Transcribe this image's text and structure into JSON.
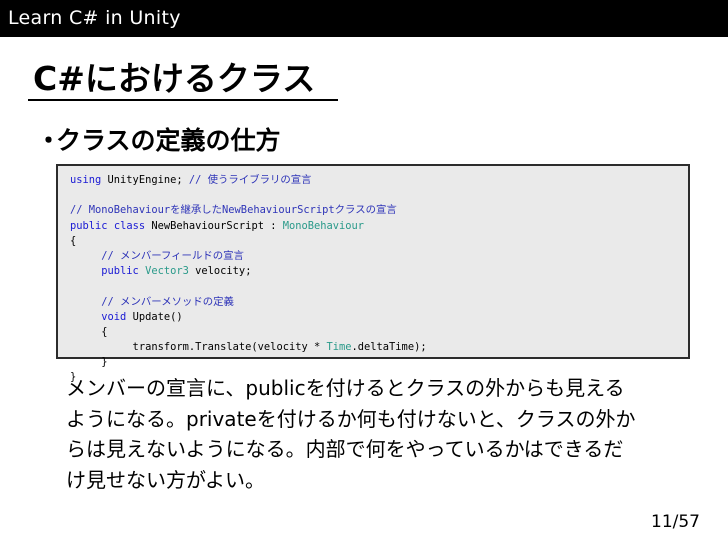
{
  "header": {
    "title": "Learn C# in Unity"
  },
  "slide": {
    "title": "C#におけるクラス",
    "bullet": {
      "marker": "・",
      "text": "クラスの定義の仕方"
    }
  },
  "code": [
    [
      {
        "t": "using",
        "c": "kw"
      },
      {
        "t": " UnityEngine; ",
        "c": ""
      },
      {
        "t": "// 使うライブラリの宣言",
        "c": "cm"
      }
    ],
    [],
    [
      {
        "t": "// MonoBehaviourを継承したNewBehaviourScriptクラスの宣言",
        "c": "cm"
      }
    ],
    [
      {
        "t": "public",
        "c": "kw"
      },
      {
        "t": " ",
        "c": ""
      },
      {
        "t": "class",
        "c": "kw"
      },
      {
        "t": " NewBehaviourScript : ",
        "c": ""
      },
      {
        "t": "MonoBehaviour",
        "c": "ty"
      }
    ],
    [
      {
        "t": "{",
        "c": ""
      }
    ],
    [
      {
        "t": "     ",
        "c": ""
      },
      {
        "t": "// メンバーフィールドの宣言",
        "c": "cm"
      }
    ],
    [
      {
        "t": "     ",
        "c": ""
      },
      {
        "t": "public",
        "c": "kw"
      },
      {
        "t": " ",
        "c": ""
      },
      {
        "t": "Vector3",
        "c": "ty"
      },
      {
        "t": " velocity;",
        "c": ""
      }
    ],
    [],
    [
      {
        "t": "     ",
        "c": ""
      },
      {
        "t": "// メンバーメソッドの定義",
        "c": "cm"
      }
    ],
    [
      {
        "t": "     ",
        "c": ""
      },
      {
        "t": "void",
        "c": "kw"
      },
      {
        "t": " Update()",
        "c": ""
      }
    ],
    [
      {
        "t": "     {",
        "c": ""
      }
    ],
    [
      {
        "t": "          transform.Translate(velocity * ",
        "c": ""
      },
      {
        "t": "Time",
        "c": "ty"
      },
      {
        "t": ".deltaTime);",
        "c": ""
      }
    ],
    [
      {
        "t": "     }",
        "c": ""
      }
    ],
    [
      {
        "t": "}",
        "c": ""
      }
    ]
  ],
  "paragraph": [
    "メンバーの宣言に、publicを付けるとクラスの外からも見える",
    "ようになる。privateを付けるか何も付けないと、クラスの外か",
    "らは見えないようになる。内部で何をやっているかはできるだ",
    "け見せない方がよい。"
  ],
  "page": {
    "number": "11/57"
  }
}
